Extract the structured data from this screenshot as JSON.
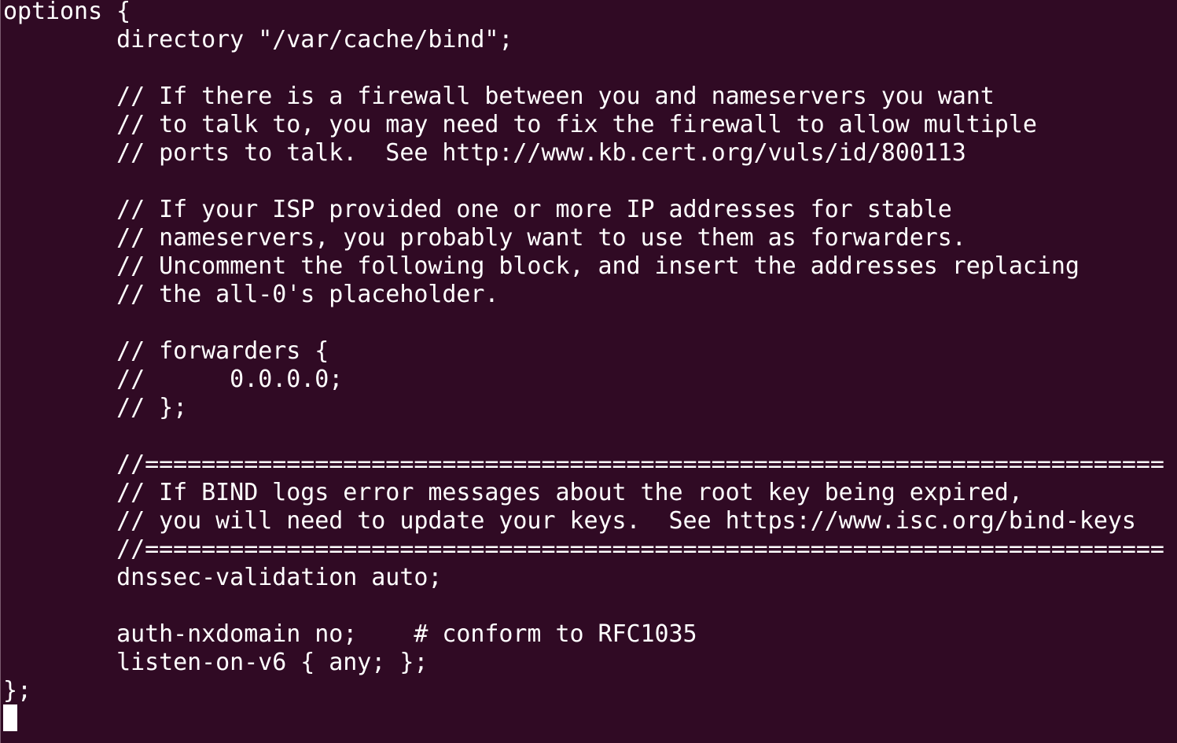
{
  "terminal": {
    "lines": [
      "options {",
      "        directory \"/var/cache/bind\";",
      "",
      "        // If there is a firewall between you and nameservers you want",
      "        // to talk to, you may need to fix the firewall to allow multiple",
      "        // ports to talk.  See http://www.kb.cert.org/vuls/id/800113",
      "",
      "        // If your ISP provided one or more IP addresses for stable",
      "        // nameservers, you probably want to use them as forwarders.",
      "        // Uncomment the following block, and insert the addresses replacing",
      "        // the all-0's placeholder.",
      "",
      "        // forwarders {",
      "        //      0.0.0.0;",
      "        // };",
      "",
      "        //========================================================================",
      "        // If BIND logs error messages about the root key being expired,",
      "        // you will need to update your keys.  See https://www.isc.org/bind-keys",
      "        //========================================================================",
      "        dnssec-validation auto;",
      "",
      "        auth-nxdomain no;    # conform to RFC1035",
      "        listen-on-v6 { any; };",
      "};",
      ""
    ]
  },
  "colors": {
    "background": "#300a24",
    "foreground": "#ffffff",
    "cursor": "#ffffff"
  }
}
